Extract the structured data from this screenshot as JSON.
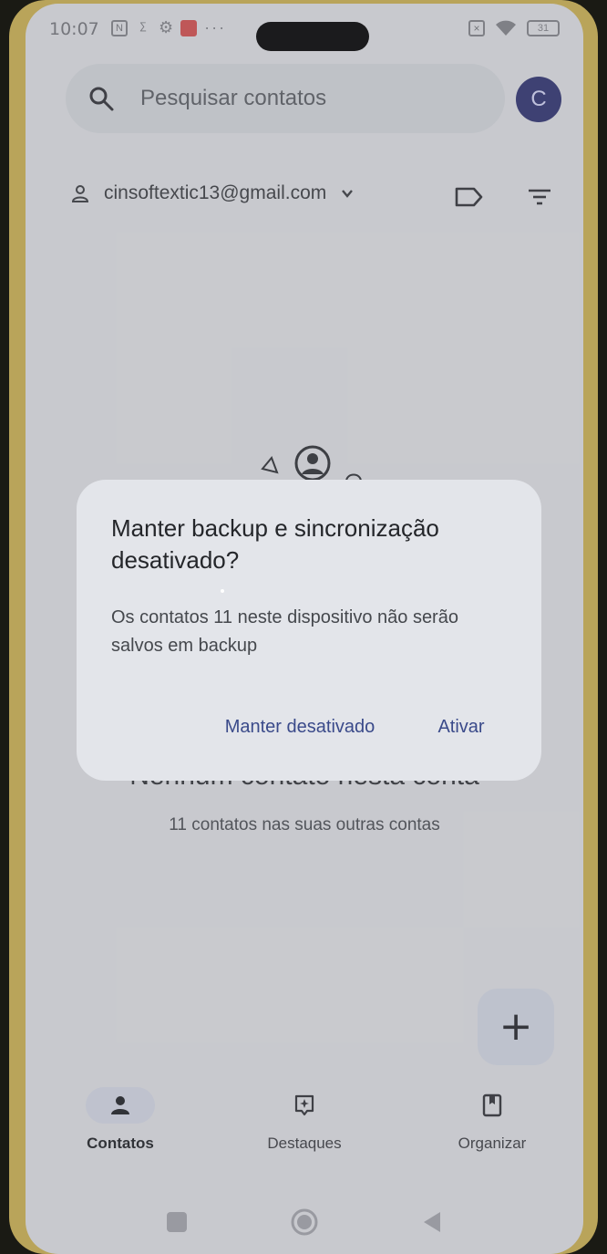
{
  "status_bar": {
    "time": "10:07",
    "battery": "31",
    "icons": [
      "nfc-icon",
      "sim-icon",
      "settings-icon",
      "app-notification-icon",
      "more-dots-icon",
      "sim-off-icon",
      "wifi-icon",
      "battery-icon"
    ]
  },
  "search": {
    "placeholder": "Pesquisar contatos",
    "avatar_initial": "C"
  },
  "account": {
    "email": "cinsoftextic13@gmail.com"
  },
  "empty_state": {
    "title": "Nenhum contato nesta conta",
    "subtitle": "11 contatos nas suas outras contas"
  },
  "dialog": {
    "title": "Manter backup e sincronização desativado?",
    "body": "Os contatos 11 neste dispositivo não serão salvos em backup",
    "keep_off_label": "Manter desativado",
    "turn_on_label": "Ativar"
  },
  "fab": {
    "label": "+"
  },
  "bottom_nav": {
    "items": [
      {
        "label": "Contatos",
        "icon": "person-icon",
        "active": true
      },
      {
        "label": "Destaques",
        "icon": "highlights-icon",
        "active": false
      },
      {
        "label": "Organizar",
        "icon": "organize-icon",
        "active": false
      }
    ]
  },
  "colors": {
    "accent": "#3a4a8a",
    "avatar_bg": "#2b2f6a",
    "dialog_bg": "#e3e5ea",
    "screen_bg": "#d4d5d8"
  }
}
